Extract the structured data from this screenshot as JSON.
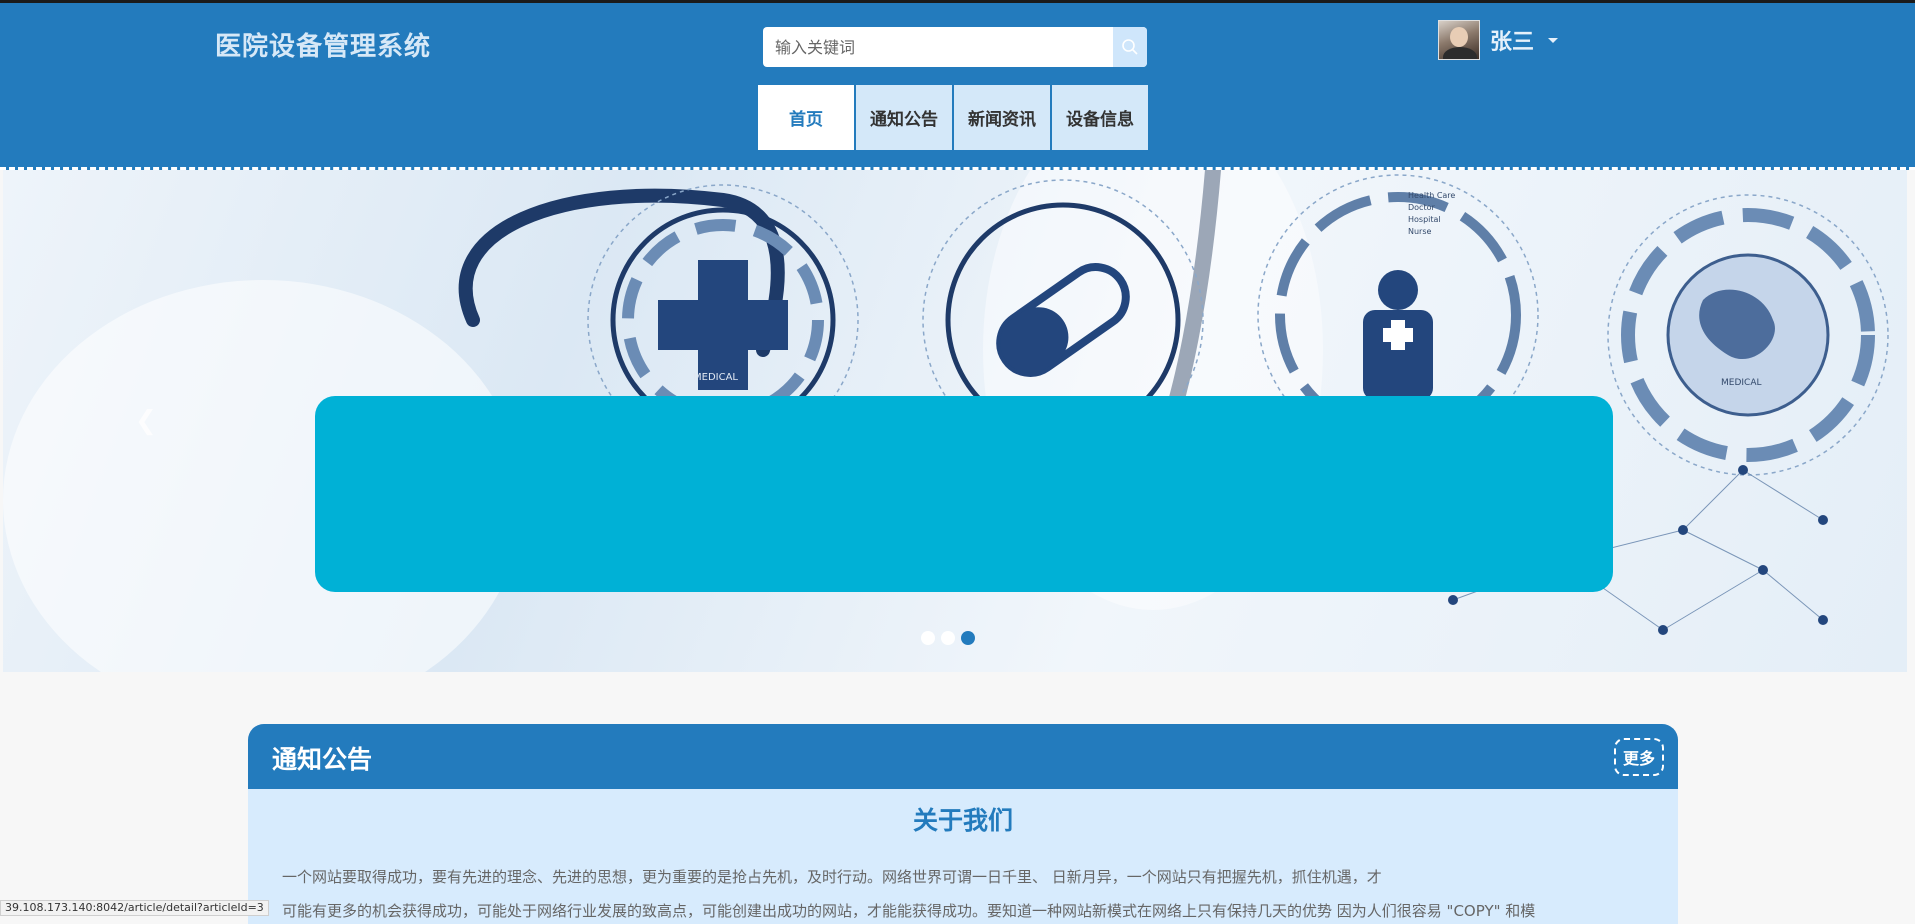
{
  "header": {
    "site_title": "医院设备管理系统",
    "search": {
      "placeholder": "输入关键词"
    },
    "nav": [
      {
        "label": "首页",
        "active": true
      },
      {
        "label": "通知公告",
        "active": false
      },
      {
        "label": "新闻资讯",
        "active": false
      },
      {
        "label": "设备信息",
        "active": false
      }
    ],
    "user": {
      "name": "张三"
    }
  },
  "banner": {
    "slides": 3,
    "active_slide": 3
  },
  "notice": {
    "title": "通知公告",
    "more_label": "更多",
    "article": {
      "title": "关于我们",
      "lines": [
        "一个网站要取得成功，要有先进的理念、先进的思想，更为重要的是抢占先机，及时行动。网络世界可谓一日千里、 日新月异，一个网站只有把握先机，抓住机遇，才",
        "可能有更多的机会获得成功，可能处于网络行业发展的致高点，可能创建出成功的网站，才能能获得成功。要知道一种网站新模式在网络上只有保持几天的优势 因为人们很容易 \"COPY\" 和模"
      ]
    }
  },
  "status_bar": {
    "url": "39.108.173.140:8042/article/detail?articleId=3"
  },
  "colors": {
    "primary": "#237bbd",
    "nav_bg": "#d4e8f9",
    "banner_overlay": "#00b1d6",
    "notice_body_bg": "#d7ebfd"
  }
}
